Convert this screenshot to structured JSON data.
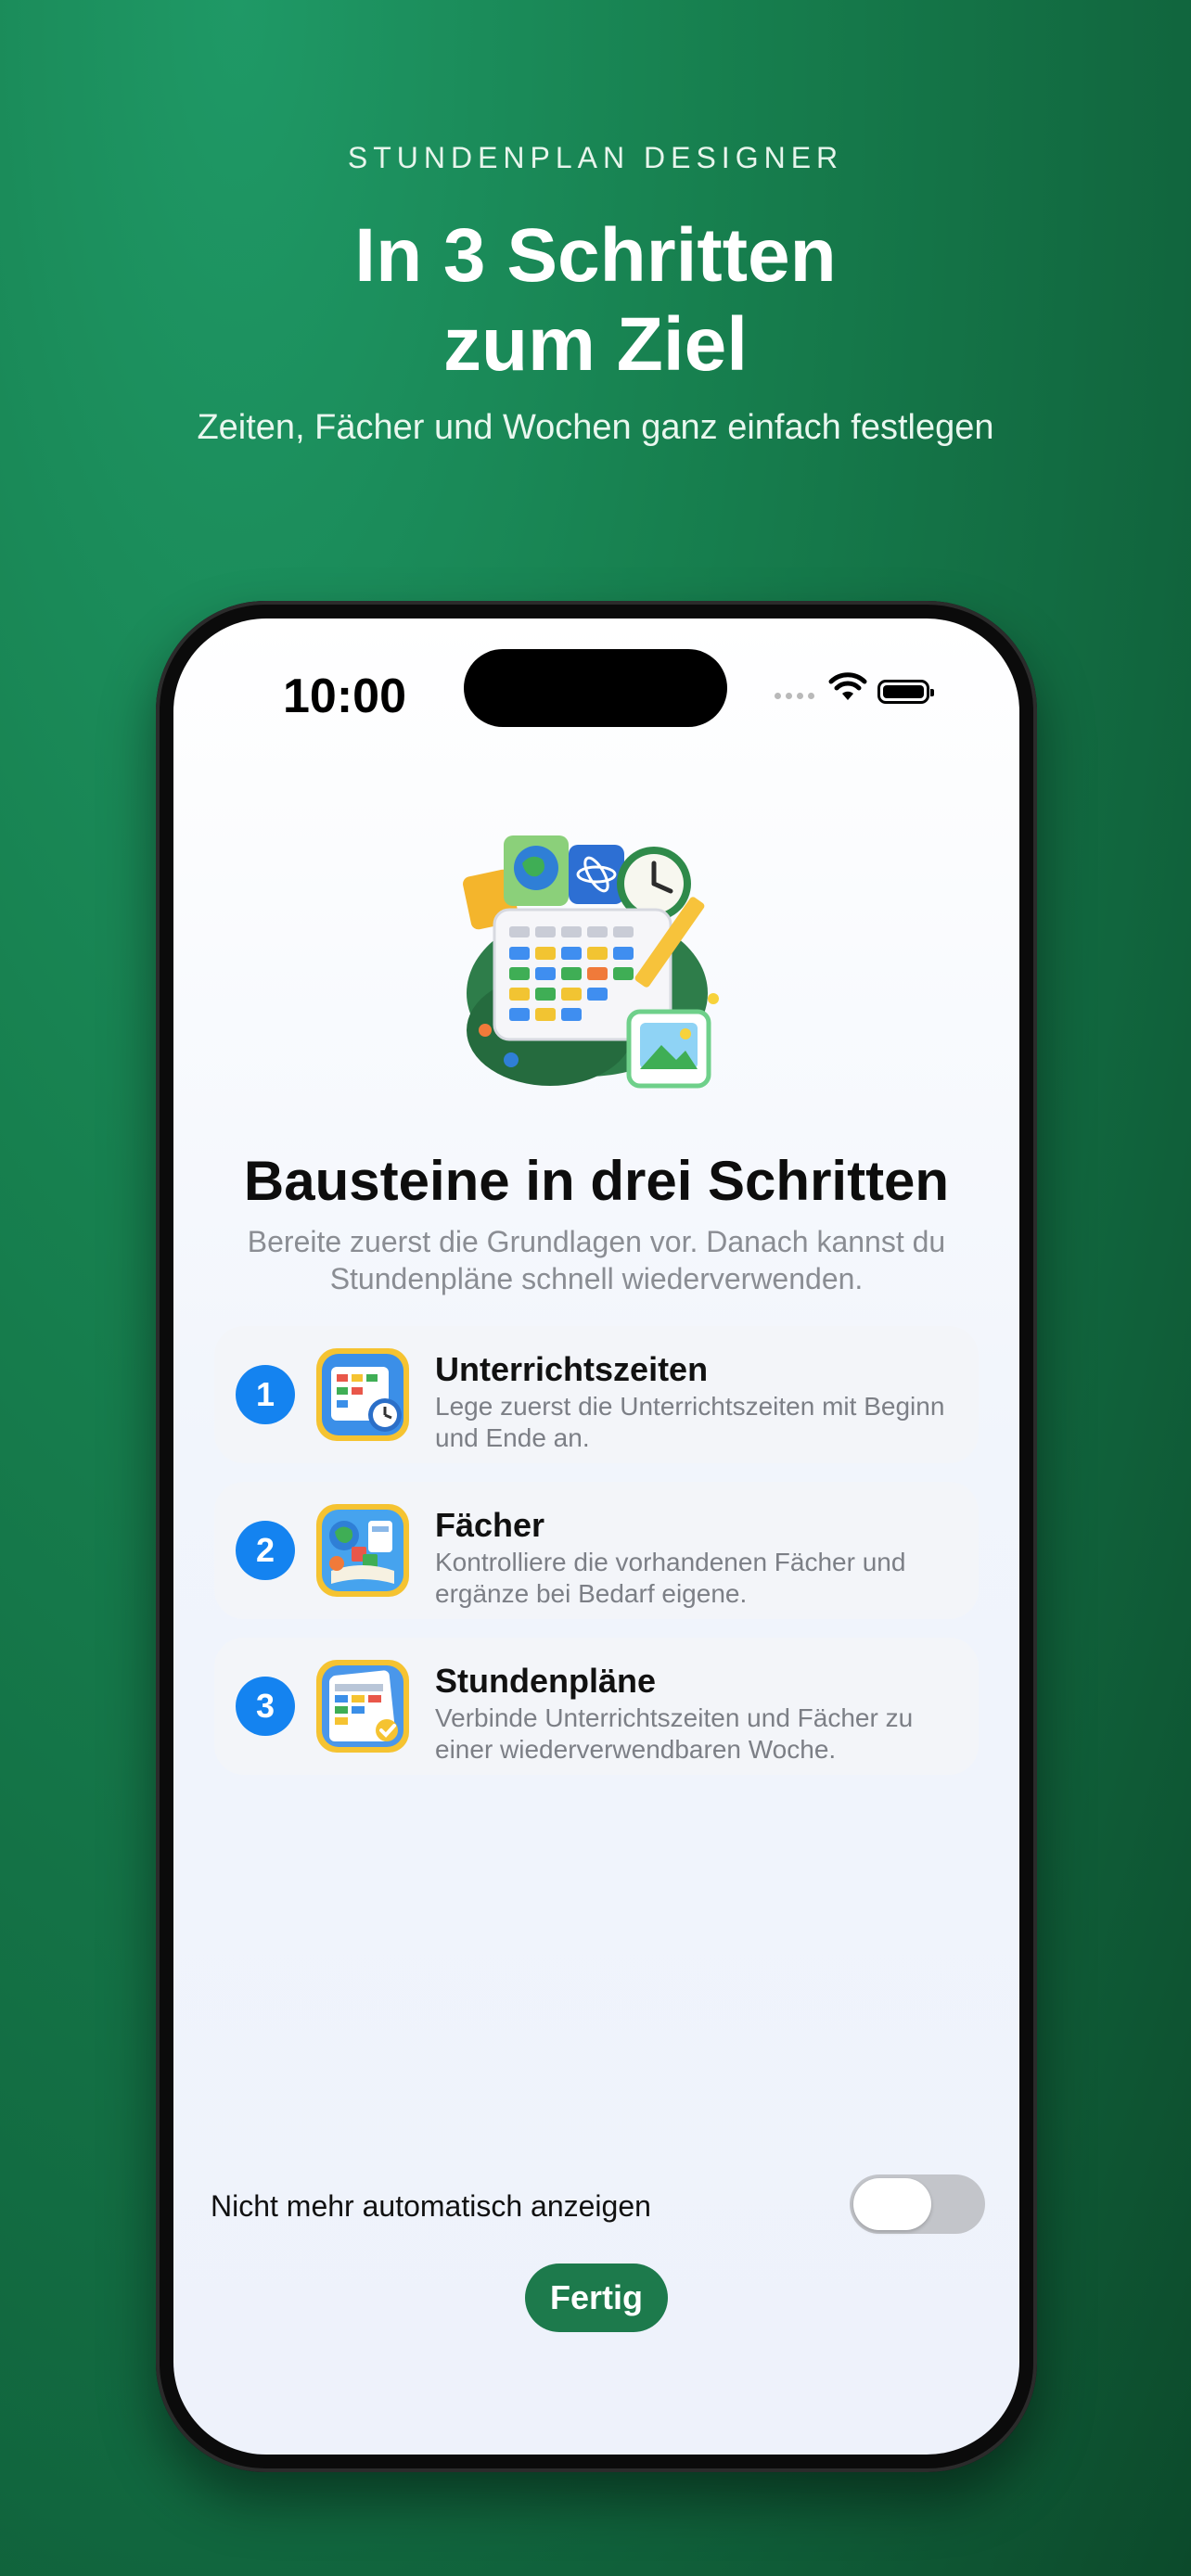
{
  "header": {
    "kicker": "STUNDENPLAN DESIGNER",
    "headline_line1": "In 3 Schritten",
    "headline_line2": "zum Ziel",
    "subtitle": "Zeiten, Fächer und Wochen ganz einfach festlegen"
  },
  "status_bar": {
    "time": "10:00"
  },
  "onboarding": {
    "title": "Bausteine in drei Schritten",
    "description": "Bereite zuerst die Grundlagen vor. Danach kannst du Stundenpläne schnell wiederverwenden."
  },
  "steps": [
    {
      "number": "1",
      "title": "Unterrichtszeiten",
      "description": "Lege zuerst die Unterrichtszeiten mit Beginn und Ende an.",
      "icon": "calendar-clock-icon"
    },
    {
      "number": "2",
      "title": "Fächer",
      "description": "Kontrolliere die vorhandenen Fächer und ergänze bei Bedarf eigene.",
      "icon": "subjects-icon"
    },
    {
      "number": "3",
      "title": "Stundenpläne",
      "description": "Verbinde Unterrichtszeiten und Fächer zu einer wiederverwendbaren Woche.",
      "icon": "timetable-icon"
    }
  ],
  "footer": {
    "toggle_label": "Nicht mehr automatisch anzeigen",
    "toggle_on": false,
    "done_label": "Fertig"
  },
  "colors": {
    "accent_green": "#1d7a4c",
    "step_number_blue": "#1483f0",
    "background_green": "#17804f"
  }
}
